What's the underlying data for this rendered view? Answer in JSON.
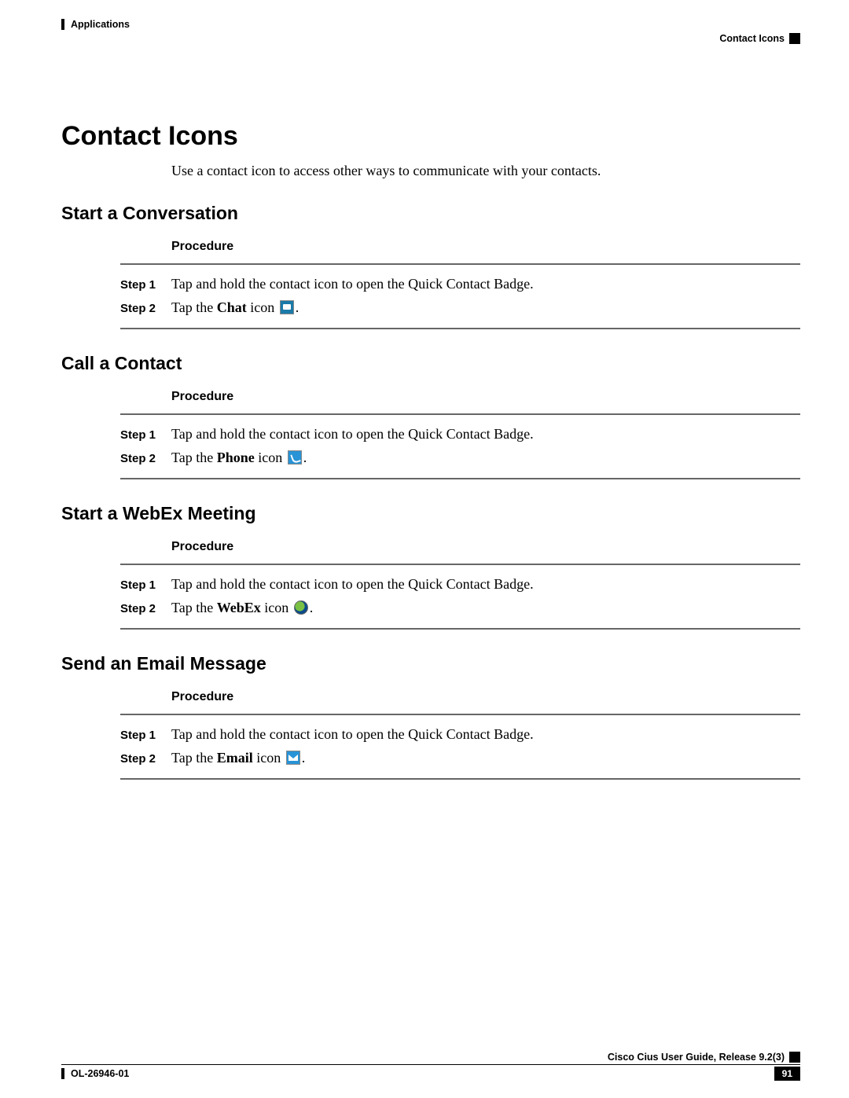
{
  "header": {
    "chapter": "Applications",
    "section": "Contact Icons"
  },
  "title": "Contact Icons",
  "intro": "Use a contact icon to access other ways to communicate with your contacts.",
  "procedure_label": "Procedure",
  "step_prefix": "Step",
  "sections": [
    {
      "heading": "Start a Conversation",
      "steps": [
        {
          "n": "1",
          "text": "Tap and hold the contact icon to open the Quick Contact Badge."
        },
        {
          "n": "2",
          "prefix": "Tap the ",
          "bold": "Chat",
          "suffix": " icon ",
          "icon": "chat",
          "tail": "."
        }
      ]
    },
    {
      "heading": "Call a Contact",
      "steps": [
        {
          "n": "1",
          "text": "Tap and hold the contact icon to open the Quick Contact Badge."
        },
        {
          "n": "2",
          "prefix": "Tap the ",
          "bold": "Phone",
          "suffix": " icon ",
          "icon": "phone",
          "tail": "."
        }
      ]
    },
    {
      "heading": "Start a WebEx Meeting",
      "steps": [
        {
          "n": "1",
          "text": "Tap and hold the contact icon to open the Quick Contact Badge."
        },
        {
          "n": "2",
          "prefix": "Tap the ",
          "bold": "WebEx",
          "suffix": " icon ",
          "icon": "webex",
          "tail": "."
        }
      ]
    },
    {
      "heading": "Send an Email Message",
      "steps": [
        {
          "n": "1",
          "text": "Tap and hold the contact icon to open the Quick Contact Badge."
        },
        {
          "n": "2",
          "prefix": "Tap the ",
          "bold": "Email",
          "suffix": " icon ",
          "icon": "email",
          "tail": "."
        }
      ]
    }
  ],
  "footer": {
    "guide": "Cisco Cius User Guide, Release 9.2(3)",
    "docnum": "OL-26946-01",
    "page": "91"
  }
}
